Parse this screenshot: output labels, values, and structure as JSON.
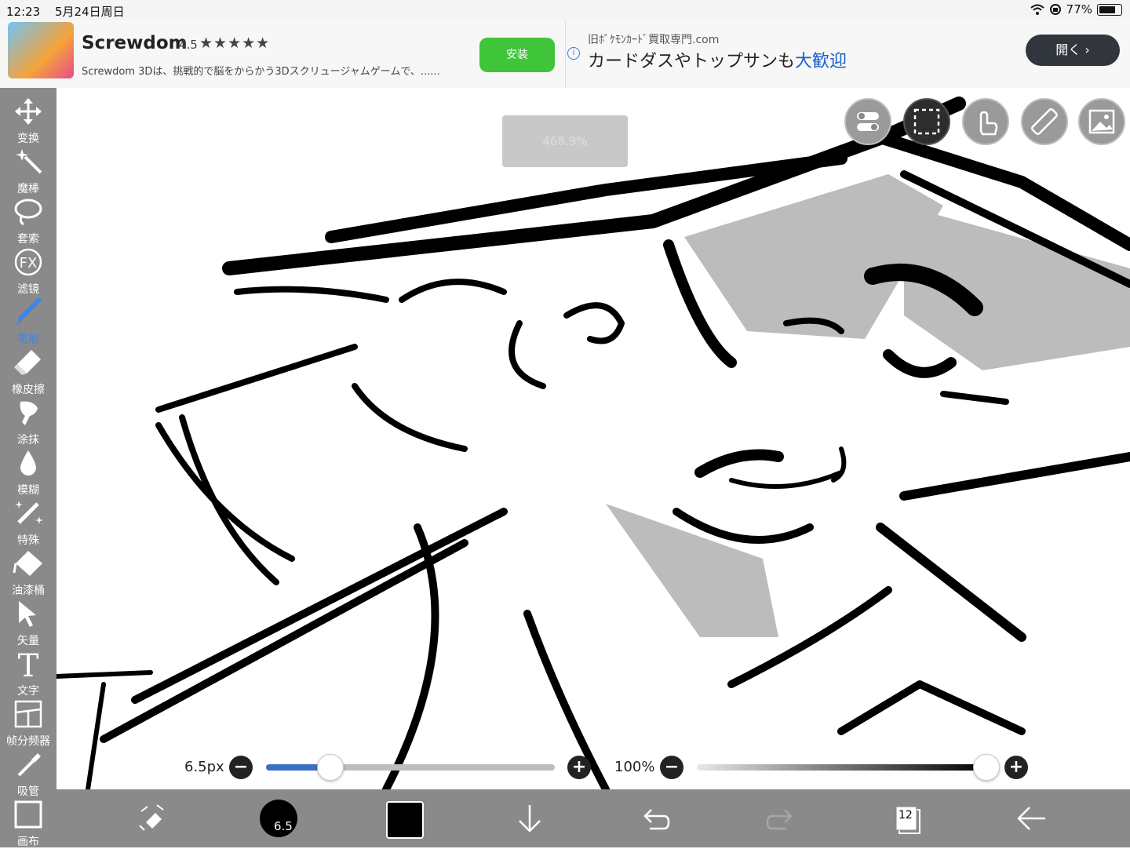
{
  "status": {
    "time": "12:23",
    "date": "5月24日周日",
    "battery": "77%"
  },
  "ad_left": {
    "app_name": "Screwdom",
    "rating": "4.5",
    "stars": "★★★★★",
    "description": "Screwdom 3Dは、挑戦的で脳をからかう3Dスクリュージャムゲームで、......",
    "install_label": "安装"
  },
  "ad_right": {
    "domain": "旧ﾎﾟｹﾓﾝｶｰﾄﾞ買取専門.com",
    "headline_prefix": "カードダスやトップサンも",
    "headline_highlight": "大歓迎",
    "open_label": "開く ›"
  },
  "tools": [
    {
      "id": "transform",
      "label": "变换",
      "icon": "move-icon"
    },
    {
      "id": "magic",
      "label": "魔棒",
      "icon": "magic-wand-icon"
    },
    {
      "id": "lasso",
      "label": "套索",
      "icon": "lasso-icon"
    },
    {
      "id": "filter",
      "label": "滤镜",
      "icon": "fx-icon"
    },
    {
      "id": "brush",
      "label": "笔刷",
      "icon": "brush-icon",
      "active": true
    },
    {
      "id": "eraser",
      "label": "橡皮擦",
      "icon": "eraser-icon"
    },
    {
      "id": "smudge",
      "label": "涂抹",
      "icon": "smudge-icon"
    },
    {
      "id": "blur",
      "label": "模糊",
      "icon": "blur-drop-icon"
    },
    {
      "id": "special",
      "label": "特殊",
      "icon": "special-pen-icon"
    },
    {
      "id": "bucket",
      "label": "油漆桶",
      "icon": "paint-bucket-icon"
    },
    {
      "id": "vector",
      "label": "矢量",
      "icon": "vector-arrow-icon"
    },
    {
      "id": "text",
      "label": "文字",
      "icon": "text-icon"
    },
    {
      "id": "frames",
      "label": "帧分频器",
      "icon": "frame-divider-icon"
    },
    {
      "id": "dropper",
      "label": "吸管",
      "icon": "eyedropper-icon"
    },
    {
      "id": "canvas",
      "label": "画布",
      "icon": "canvas-icon"
    }
  ],
  "zoom_indicator": "468.9%",
  "brush_size": {
    "label": "6.5px",
    "value": 0.22
  },
  "opacity": {
    "label": "100%",
    "value": 1.0
  },
  "bottom": {
    "brush_size_badge": "6.5",
    "layers_count": "12"
  }
}
